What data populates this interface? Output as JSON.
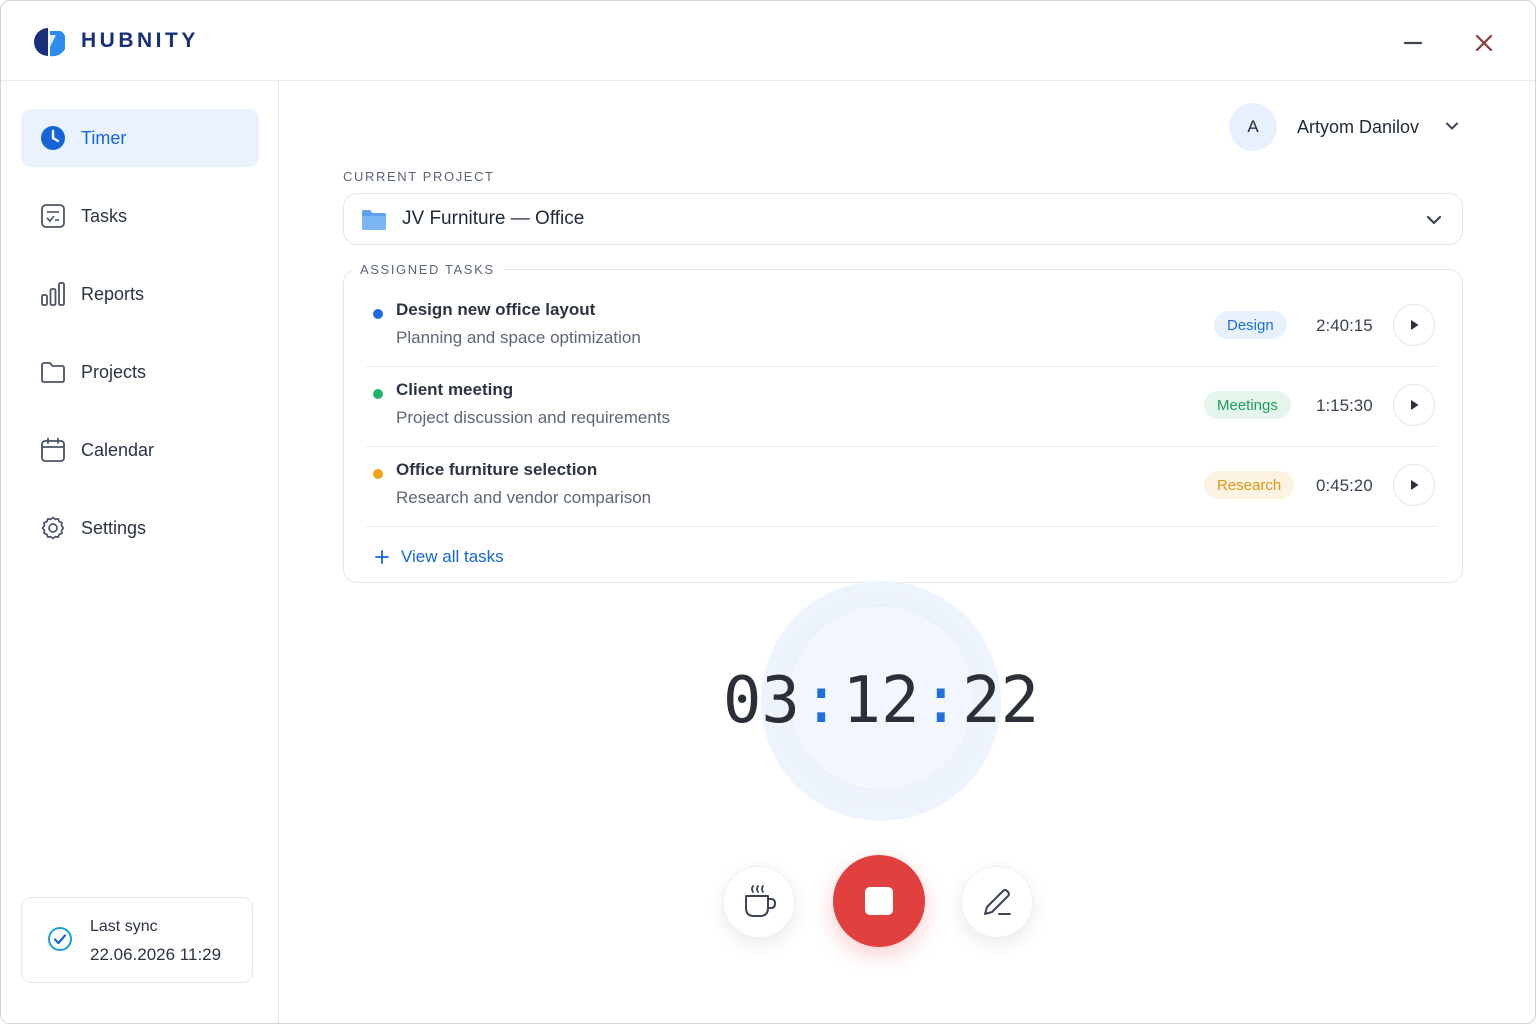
{
  "app": {
    "brand": "HUBNITY"
  },
  "sidebar": {
    "items": [
      {
        "label": "Timer",
        "icon": "clock-icon",
        "active": true
      },
      {
        "label": "Tasks",
        "icon": "tasks-icon",
        "active": false
      },
      {
        "label": "Reports",
        "icon": "bar-chart-icon",
        "active": false
      },
      {
        "label": "Projects",
        "icon": "folder-icon",
        "active": false
      },
      {
        "label": "Calendar",
        "icon": "calendar-icon",
        "active": false
      },
      {
        "label": "Settings",
        "icon": "gear-icon",
        "active": false
      }
    ],
    "sync": {
      "title": "Last sync",
      "time": "22.06.2026 11:29"
    }
  },
  "user": {
    "initial": "A",
    "name": "Artyom Danilov"
  },
  "project": {
    "label": "CURRENT PROJECT",
    "name": "JV Furniture — Office"
  },
  "tasks": {
    "label": "ASSIGNED TASKS",
    "items": [
      {
        "title": "Design new office layout",
        "subtitle": "Planning and space optimization",
        "tag": "Design",
        "time": "2:40:15",
        "dot_color": "#1a6de0",
        "tag_bg": "#e7f1fd",
        "tag_color": "#1d6fd8"
      },
      {
        "title": "Client meeting",
        "subtitle": "Project discussion and requirements",
        "tag": "Meetings",
        "time": "1:15:30",
        "dot_color": "#20b26b",
        "tag_bg": "#e4f6ec",
        "tag_color": "#1f9d5c"
      },
      {
        "title": "Office furniture selection",
        "subtitle": "Research and vendor comparison",
        "tag": "Research",
        "time": "0:45:20",
        "dot_color": "#f4a21a",
        "tag_bg": "#fdf3e2",
        "tag_color": "#e19417"
      }
    ],
    "view_all": "View all tasks"
  },
  "timer": {
    "hours": "03",
    "minutes": "12",
    "seconds": "22"
  },
  "colors": {
    "accent": "#1565d8",
    "stop": "#e2403e",
    "brand": "#16307a"
  }
}
